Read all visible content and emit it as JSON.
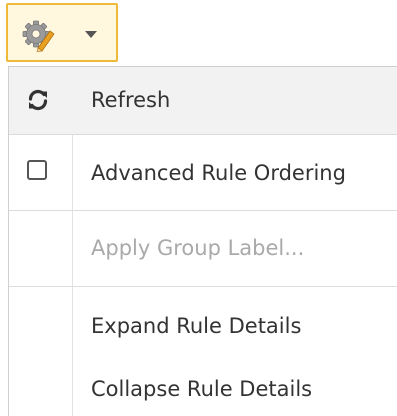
{
  "trigger": {
    "icon": "gear-icon",
    "caret_icon": "caret-down-icon",
    "accent_border": "#efb93a",
    "accent_background": "#fff8de"
  },
  "menu": {
    "items": [
      {
        "label": "Refresh",
        "icon": "refresh-icon",
        "enabled": true
      },
      {
        "label": "Advanced Rule Ordering",
        "icon": "checkbox-icon",
        "checked": false,
        "enabled": true
      },
      {
        "label": "Apply Group Label...",
        "enabled": false
      },
      {
        "label": "Expand Rule Details",
        "enabled": true
      },
      {
        "label": "Collapse Rule Details",
        "enabled": true
      }
    ]
  }
}
